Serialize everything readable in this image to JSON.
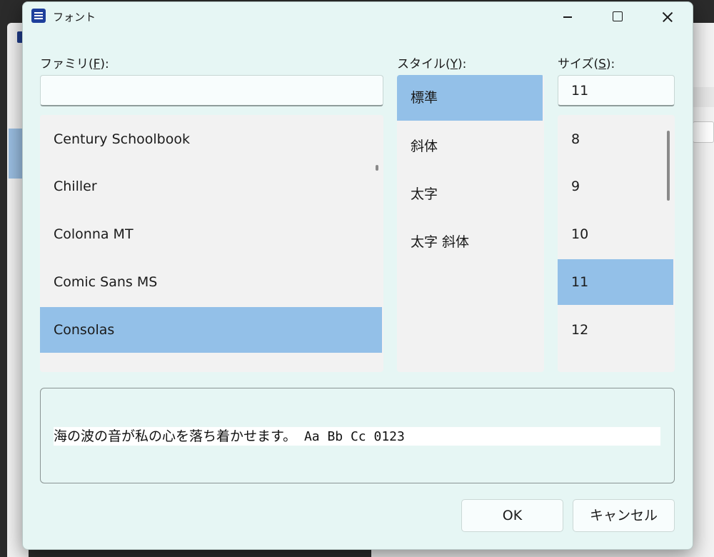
{
  "dialog": {
    "title": "フォント",
    "family_label_pre": "ファミリ(",
    "family_label_key": "F",
    "family_label_post": "):",
    "style_label_pre": "スタイル(",
    "style_label_key": "Y",
    "style_label_post": "):",
    "size_label_pre": "サイズ(",
    "size_label_key": "S",
    "size_label_post": "):",
    "family_input_value": "",
    "size_input_value": "11",
    "families": [
      "Century Schoolbook",
      "Chiller",
      "Colonna MT",
      "Comic Sans MS",
      "Consolas"
    ],
    "selected_family": "Consolas",
    "styles": [
      "標準",
      "斜体",
      "太字",
      "太字 斜体"
    ],
    "selected_style": "標準",
    "sizes": [
      "8",
      "9",
      "10",
      "11",
      "12"
    ],
    "selected_size": "11",
    "preview_jp": "海の波の音が私の心を落ち着かせます。",
    "preview_latin": " Aa Bb Cc 0123",
    "ok_label": "OK",
    "cancel_label": "キャンセル"
  },
  "colors": {
    "dialog_bg": "#e6f6f4",
    "list_bg": "#f2f2f2",
    "selection": "#93c0e8",
    "app_icon": "#1e3f9c"
  },
  "icons": {
    "app": "font-dialog-icon",
    "minimize": "minimize-icon",
    "maximize": "maximize-icon",
    "close": "close-icon"
  }
}
